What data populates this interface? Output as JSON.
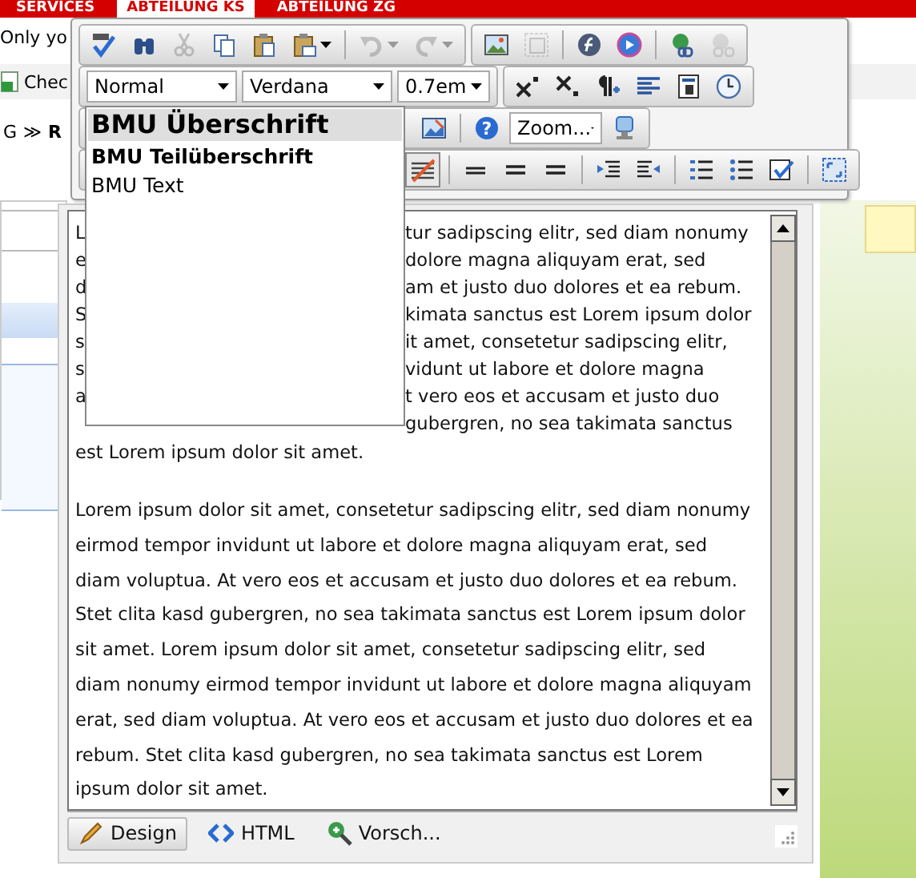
{
  "page_header": {
    "tabs": [
      {
        "label": "SERVICES",
        "selected": false
      },
      {
        "label": "ABTEILUNG KS",
        "selected": true
      },
      {
        "label": "ABTEILUNG ZG",
        "selected": false
      }
    ]
  },
  "background": {
    "notice": "Only yo",
    "checkbox_label": "Chec",
    "breadcrumb": {
      "first": "G",
      "separator": "≫",
      "current": "R"
    }
  },
  "toolbar": {
    "rows": [
      [
        {
          "items": [
            {
              "kind": "spellcheck",
              "disabled": false
            },
            {
              "kind": "binoculars",
              "disabled": false
            },
            {
              "kind": "cut",
              "disabled": true
            },
            {
              "kind": "copy",
              "disabled": false
            },
            {
              "kind": "paste",
              "disabled": false
            },
            {
              "kind": "paste-menu",
              "disabled": false
            },
            {
              "kind": "separator"
            },
            {
              "kind": "undo",
              "disabled": true
            },
            {
              "kind": "redo",
              "disabled": true
            }
          ]
        },
        {
          "items": [
            {
              "kind": "image",
              "disabled": false
            },
            {
              "kind": "image-map",
              "disabled": true
            },
            {
              "kind": "separator"
            },
            {
              "kind": "flash",
              "disabled": false
            },
            {
              "kind": "media",
              "disabled": false
            },
            {
              "kind": "separator"
            },
            {
              "kind": "link",
              "disabled": false
            },
            {
              "kind": "unlink",
              "disabled": true
            }
          ]
        }
      ],
      [
        {
          "items": [
            {
              "kind": "select",
              "value": "Normal"
            },
            {
              "kind": "select",
              "value": "Verdana"
            },
            {
              "kind": "select",
              "value": "0.7em"
            }
          ]
        },
        {
          "items": [
            {
              "kind": "superscript",
              "disabled": false
            },
            {
              "kind": "subscript",
              "disabled": false
            },
            {
              "kind": "paragraph",
              "disabled": false
            },
            {
              "kind": "align",
              "disabled": false
            },
            {
              "kind": "template",
              "disabled": false
            },
            {
              "kind": "clock",
              "disabled": false
            }
          ]
        }
      ],
      [
        {
          "items": [
            {
              "kind": "hidden-caret"
            },
            {
              "kind": "image-edit",
              "disabled": false
            },
            {
              "kind": "separator"
            },
            {
              "kind": "help",
              "disabled": false,
              "glyph": "?"
            },
            {
              "kind": "select",
              "value": "Zoom..."
            },
            {
              "kind": "monitor",
              "disabled": false
            }
          ]
        }
      ],
      [
        {
          "items": [
            {
              "kind": "strike",
              "disabled": false
            },
            {
              "kind": "separator"
            },
            {
              "kind": "rule",
              "disabled": false
            },
            {
              "kind": "rule2",
              "disabled": false
            },
            {
              "kind": "rule2",
              "disabled": false
            },
            {
              "kind": "separator"
            },
            {
              "kind": "indent",
              "disabled": false
            },
            {
              "kind": "outdent",
              "disabled": false
            },
            {
              "kind": "separator"
            },
            {
              "kind": "numbered-list",
              "disabled": false
            },
            {
              "kind": "bullet-list",
              "disabled": false
            },
            {
              "kind": "checkbox",
              "disabled": false
            },
            {
              "kind": "separator"
            },
            {
              "kind": "fullscreen",
              "disabled": false
            }
          ]
        }
      ]
    ]
  },
  "format_dropdown": {
    "options": [
      {
        "label": "BMU Überschrift",
        "selected": true
      },
      {
        "label": "BMU Teilüberschrift",
        "selected": false
      },
      {
        "label": "BMU Text",
        "selected": false
      }
    ]
  },
  "editor": {
    "partial_lines": [
      {
        "left": "L",
        "right": "tur sadipscing elitr, sed diam nonumy"
      },
      {
        "left": "e",
        "right": "dolore magna aliquyam erat, sed"
      },
      {
        "left": "d",
        "right": "am et justo duo dolores et ea rebum."
      },
      {
        "left": "S",
        "right": "kimata sanctus est Lorem ipsum dolor"
      },
      {
        "left": "s",
        "right": "it amet, consetetur sadipscing elitr,"
      },
      {
        "left": "s",
        "right": "vidunt ut labore et dolore magna"
      },
      {
        "left": "a",
        "right": "t vero eos et accusam et justo duo"
      },
      {
        "right": "gubergren, no sea takimata sanctus"
      }
    ],
    "paragraph_1_end": "est Lorem ipsum dolor sit amet.",
    "paragraph_2": "Lorem ipsum dolor sit amet, consetetur sadipscing elitr, sed diam nonumy eirmod tempor invidunt ut labore et dolore magna aliquyam erat, sed diam voluptua. At vero eos et accusam et justo duo dolores et ea rebum. Stet clita kasd gubergren, no sea takimata sanctus est Lorem ipsum dolor sit amet. Lorem ipsum dolor sit amet, consetetur sadipscing elitr, sed diam nonumy eirmod tempor invidunt ut labore et dolore magna aliquyam erat, sed diam voluptua. At vero eos et accusam et justo duo dolores et ea rebum. Stet clita kasd gubergren, no sea takimata sanctus est Lorem ipsum dolor sit amet."
  },
  "mode_tabs": [
    {
      "label": "Design",
      "kind": "design",
      "selected": true
    },
    {
      "label": "HTML",
      "kind": "html",
      "selected": false
    },
    {
      "label": "Vorsch...",
      "kind": "preview",
      "selected": false
    }
  ]
}
